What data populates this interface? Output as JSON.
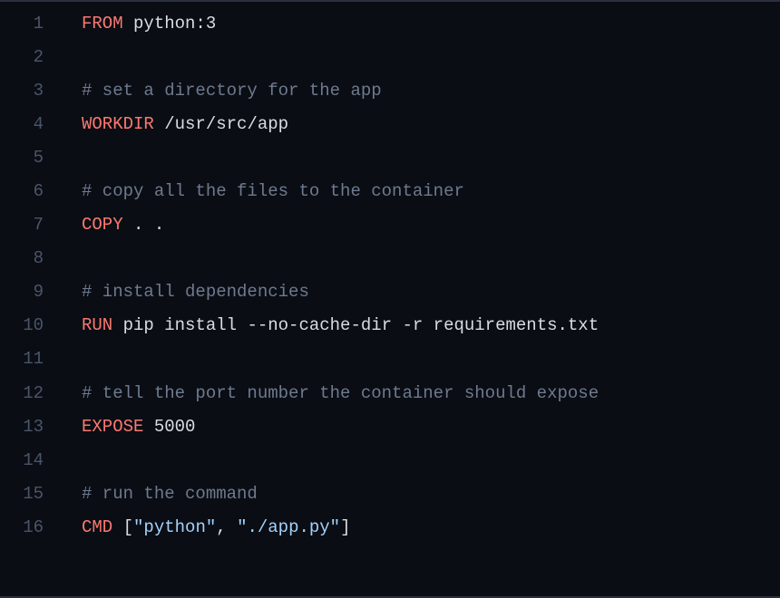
{
  "editor": {
    "lines": [
      {
        "num": "1",
        "tokens": [
          {
            "cls": "kw",
            "t": "FROM"
          },
          {
            "cls": "txt",
            "t": " python:3"
          }
        ]
      },
      {
        "num": "2",
        "tokens": []
      },
      {
        "num": "3",
        "tokens": [
          {
            "cls": "comment",
            "t": "# set a directory for the app"
          }
        ]
      },
      {
        "num": "4",
        "tokens": [
          {
            "cls": "kw",
            "t": "WORKDIR"
          },
          {
            "cls": "txt",
            "t": " /usr/src/app"
          }
        ]
      },
      {
        "num": "5",
        "tokens": []
      },
      {
        "num": "6",
        "tokens": [
          {
            "cls": "comment",
            "t": "# copy all the files to the container"
          }
        ]
      },
      {
        "num": "7",
        "tokens": [
          {
            "cls": "kw",
            "t": "COPY"
          },
          {
            "cls": "txt",
            "t": " . ."
          }
        ]
      },
      {
        "num": "8",
        "tokens": []
      },
      {
        "num": "9",
        "tokens": [
          {
            "cls": "comment",
            "t": "# install dependencies"
          }
        ]
      },
      {
        "num": "10",
        "tokens": [
          {
            "cls": "kw",
            "t": "RUN"
          },
          {
            "cls": "txt",
            "t": " pip install --no-cache-dir -r requirements.txt"
          }
        ]
      },
      {
        "num": "11",
        "tokens": []
      },
      {
        "num": "12",
        "tokens": [
          {
            "cls": "comment",
            "t": "# tell the port number the container should expose"
          }
        ]
      },
      {
        "num": "13",
        "tokens": [
          {
            "cls": "kw",
            "t": "EXPOSE"
          },
          {
            "cls": "txt",
            "t": " 5000"
          }
        ]
      },
      {
        "num": "14",
        "tokens": []
      },
      {
        "num": "15",
        "tokens": [
          {
            "cls": "comment",
            "t": "# run the command"
          }
        ]
      },
      {
        "num": "16",
        "tokens": [
          {
            "cls": "kw",
            "t": "CMD"
          },
          {
            "cls": "txt",
            "t": " "
          },
          {
            "cls": "punct",
            "t": "["
          },
          {
            "cls": "str",
            "t": "\"python\""
          },
          {
            "cls": "punct",
            "t": ", "
          },
          {
            "cls": "str",
            "t": "\"./app.py\""
          },
          {
            "cls": "punct",
            "t": "]"
          }
        ]
      }
    ]
  }
}
